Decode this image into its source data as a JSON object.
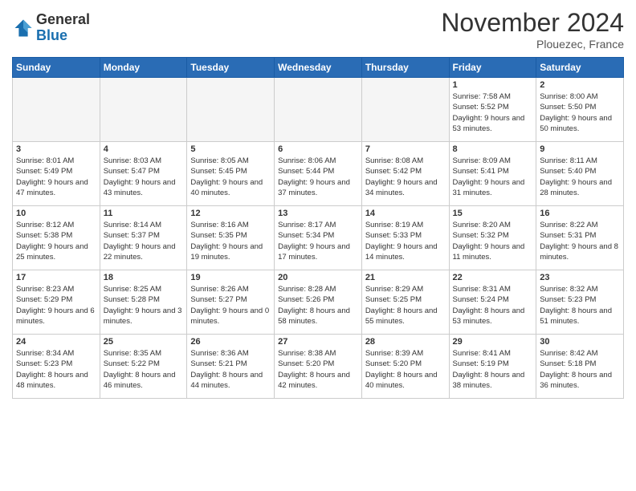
{
  "header": {
    "logo_line1": "General",
    "logo_line2": "Blue",
    "month": "November 2024",
    "location": "Plouezec, France"
  },
  "days_of_week": [
    "Sunday",
    "Monday",
    "Tuesday",
    "Wednesday",
    "Thursday",
    "Friday",
    "Saturday"
  ],
  "weeks": [
    [
      {
        "day": "",
        "info": ""
      },
      {
        "day": "",
        "info": ""
      },
      {
        "day": "",
        "info": ""
      },
      {
        "day": "",
        "info": ""
      },
      {
        "day": "",
        "info": ""
      },
      {
        "day": "1",
        "info": "Sunrise: 7:58 AM\nSunset: 5:52 PM\nDaylight: 9 hours and 53 minutes."
      },
      {
        "day": "2",
        "info": "Sunrise: 8:00 AM\nSunset: 5:50 PM\nDaylight: 9 hours and 50 minutes."
      }
    ],
    [
      {
        "day": "3",
        "info": "Sunrise: 8:01 AM\nSunset: 5:49 PM\nDaylight: 9 hours and 47 minutes."
      },
      {
        "day": "4",
        "info": "Sunrise: 8:03 AM\nSunset: 5:47 PM\nDaylight: 9 hours and 43 minutes."
      },
      {
        "day": "5",
        "info": "Sunrise: 8:05 AM\nSunset: 5:45 PM\nDaylight: 9 hours and 40 minutes."
      },
      {
        "day": "6",
        "info": "Sunrise: 8:06 AM\nSunset: 5:44 PM\nDaylight: 9 hours and 37 minutes."
      },
      {
        "day": "7",
        "info": "Sunrise: 8:08 AM\nSunset: 5:42 PM\nDaylight: 9 hours and 34 minutes."
      },
      {
        "day": "8",
        "info": "Sunrise: 8:09 AM\nSunset: 5:41 PM\nDaylight: 9 hours and 31 minutes."
      },
      {
        "day": "9",
        "info": "Sunrise: 8:11 AM\nSunset: 5:40 PM\nDaylight: 9 hours and 28 minutes."
      }
    ],
    [
      {
        "day": "10",
        "info": "Sunrise: 8:12 AM\nSunset: 5:38 PM\nDaylight: 9 hours and 25 minutes."
      },
      {
        "day": "11",
        "info": "Sunrise: 8:14 AM\nSunset: 5:37 PM\nDaylight: 9 hours and 22 minutes."
      },
      {
        "day": "12",
        "info": "Sunrise: 8:16 AM\nSunset: 5:35 PM\nDaylight: 9 hours and 19 minutes."
      },
      {
        "day": "13",
        "info": "Sunrise: 8:17 AM\nSunset: 5:34 PM\nDaylight: 9 hours and 17 minutes."
      },
      {
        "day": "14",
        "info": "Sunrise: 8:19 AM\nSunset: 5:33 PM\nDaylight: 9 hours and 14 minutes."
      },
      {
        "day": "15",
        "info": "Sunrise: 8:20 AM\nSunset: 5:32 PM\nDaylight: 9 hours and 11 minutes."
      },
      {
        "day": "16",
        "info": "Sunrise: 8:22 AM\nSunset: 5:31 PM\nDaylight: 9 hours and 8 minutes."
      }
    ],
    [
      {
        "day": "17",
        "info": "Sunrise: 8:23 AM\nSunset: 5:29 PM\nDaylight: 9 hours and 6 minutes."
      },
      {
        "day": "18",
        "info": "Sunrise: 8:25 AM\nSunset: 5:28 PM\nDaylight: 9 hours and 3 minutes."
      },
      {
        "day": "19",
        "info": "Sunrise: 8:26 AM\nSunset: 5:27 PM\nDaylight: 9 hours and 0 minutes."
      },
      {
        "day": "20",
        "info": "Sunrise: 8:28 AM\nSunset: 5:26 PM\nDaylight: 8 hours and 58 minutes."
      },
      {
        "day": "21",
        "info": "Sunrise: 8:29 AM\nSunset: 5:25 PM\nDaylight: 8 hours and 55 minutes."
      },
      {
        "day": "22",
        "info": "Sunrise: 8:31 AM\nSunset: 5:24 PM\nDaylight: 8 hours and 53 minutes."
      },
      {
        "day": "23",
        "info": "Sunrise: 8:32 AM\nSunset: 5:23 PM\nDaylight: 8 hours and 51 minutes."
      }
    ],
    [
      {
        "day": "24",
        "info": "Sunrise: 8:34 AM\nSunset: 5:23 PM\nDaylight: 8 hours and 48 minutes."
      },
      {
        "day": "25",
        "info": "Sunrise: 8:35 AM\nSunset: 5:22 PM\nDaylight: 8 hours and 46 minutes."
      },
      {
        "day": "26",
        "info": "Sunrise: 8:36 AM\nSunset: 5:21 PM\nDaylight: 8 hours and 44 minutes."
      },
      {
        "day": "27",
        "info": "Sunrise: 8:38 AM\nSunset: 5:20 PM\nDaylight: 8 hours and 42 minutes."
      },
      {
        "day": "28",
        "info": "Sunrise: 8:39 AM\nSunset: 5:20 PM\nDaylight: 8 hours and 40 minutes."
      },
      {
        "day": "29",
        "info": "Sunrise: 8:41 AM\nSunset: 5:19 PM\nDaylight: 8 hours and 38 minutes."
      },
      {
        "day": "30",
        "info": "Sunrise: 8:42 AM\nSunset: 5:18 PM\nDaylight: 8 hours and 36 minutes."
      }
    ]
  ]
}
